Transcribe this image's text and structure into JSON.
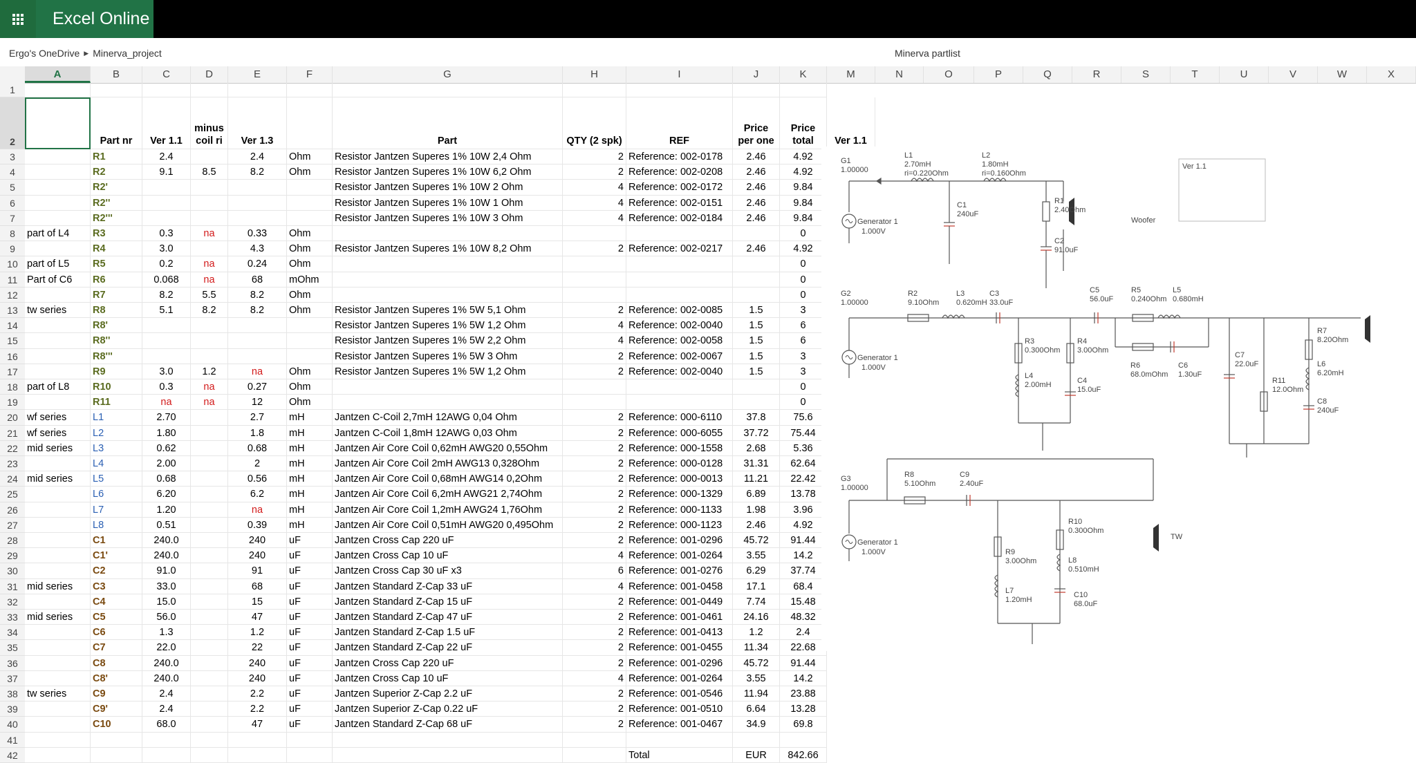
{
  "app": {
    "name": "Excel Online"
  },
  "breadcrumb": {
    "drive": "Ergo's OneDrive",
    "folder": "Minerva_project"
  },
  "document": {
    "title": "Minerva partlist"
  },
  "columns": [
    "A",
    "B",
    "C",
    "D",
    "E",
    "F",
    "G",
    "H",
    "I",
    "J",
    "K",
    "M",
    "N",
    "O",
    "P",
    "Q",
    "R",
    "S",
    "T",
    "U",
    "V",
    "W",
    "X"
  ],
  "header_row": {
    "part_nr": "Part nr",
    "ver11": "Ver 1.1",
    "minus_coil_ri": "minus coil ri",
    "ver13": "Ver 1.3",
    "part": "Part",
    "qty": "QTY (2 spk)",
    "ref": "REF",
    "price_per_one": "Price per one",
    "price_total": "Price total",
    "ver11_schematic": "Ver 1.1"
  },
  "rows": [
    {
      "n": 3,
      "a": "",
      "b": "R1",
      "c": "2.4",
      "d": "",
      "e": "2.4",
      "f": "Ohm",
      "g": "Resistor Jantzen Superes 1% 10W 2,4 Ohm",
      "h": "2",
      "i": "Reference:  002-0178",
      "j": "2.46",
      "k": "4.92",
      "t": "r"
    },
    {
      "n": 4,
      "a": "",
      "b": "R2",
      "c": "9.1",
      "d": "8.5",
      "e": "8.2",
      "f": "Ohm",
      "g": "Resistor Jantzen Superes 1% 10W 6,2 Ohm",
      "h": "2",
      "i": "Reference:  002-0208",
      "j": "2.46",
      "k": "4.92",
      "t": "r"
    },
    {
      "n": 5,
      "a": "",
      "b": "R2'",
      "c": "",
      "d": "",
      "e": "",
      "f": "",
      "g": "Resistor Jantzen Superes 1% 10W 2 Ohm",
      "h": "4",
      "i": "Reference:  002-0172",
      "j": "2.46",
      "k": "9.84",
      "t": "r"
    },
    {
      "n": 6,
      "a": "",
      "b": "R2''",
      "c": "",
      "d": "",
      "e": "",
      "f": "",
      "g": "Resistor Jantzen Superes 1% 10W 1 Ohm",
      "h": "4",
      "i": "Reference:  002-0151",
      "j": "2.46",
      "k": "9.84",
      "t": "r"
    },
    {
      "n": 7,
      "a": "",
      "b": "R2'''",
      "c": "",
      "d": "",
      "e": "",
      "f": "",
      "g": "Resistor Jantzen Superes 1% 10W 3 Ohm",
      "h": "4",
      "i": "Reference:  002-0184",
      "j": "2.46",
      "k": "9.84",
      "t": "r"
    },
    {
      "n": 8,
      "a": "part of L4",
      "b": "R3",
      "c": "0.3",
      "d": "na",
      "e": "0.33",
      "f": "Ohm",
      "g": "",
      "h": "",
      "i": "",
      "j": "",
      "k": "0",
      "t": "r"
    },
    {
      "n": 9,
      "a": "",
      "b": "R4",
      "c": "3.0",
      "d": "",
      "e": "4.3",
      "f": "Ohm",
      "g": "Resistor Jantzen Superes 1% 10W 8,2 Ohm",
      "h": "2",
      "i": "Reference:  002-0217",
      "j": "2.46",
      "k": "4.92",
      "t": "r"
    },
    {
      "n": 10,
      "a": "part of L5",
      "b": "R5",
      "c": "0.2",
      "d": "na",
      "e": "0.24",
      "f": "Ohm",
      "g": "",
      "h": "",
      "i": "",
      "j": "",
      "k": "0",
      "t": "r"
    },
    {
      "n": 11,
      "a": "Part of C6",
      "b": "R6",
      "c": "0.068",
      "d": "na",
      "e": "68",
      "f": "mOhm",
      "g": "",
      "h": "",
      "i": "",
      "j": "",
      "k": "0",
      "t": "r"
    },
    {
      "n": 12,
      "a": "",
      "b": "R7",
      "c": "8.2",
      "d": "5.5",
      "e": "8.2",
      "f": "Ohm",
      "g": "",
      "h": "",
      "i": "",
      "j": "",
      "k": "0",
      "t": "r"
    },
    {
      "n": 13,
      "a": "tw series",
      "b": "R8",
      "c": "5.1",
      "d": "8.2",
      "e": "8.2",
      "f": "Ohm",
      "g": "Resistor Jantzen Superes 1% 5W 5,1 Ohm",
      "h": "2",
      "i": "Reference:  002-0085",
      "j": "1.5",
      "k": "3",
      "t": "r"
    },
    {
      "n": 14,
      "a": "",
      "b": "R8'",
      "c": "",
      "d": "",
      "e": "",
      "f": "",
      "g": "Resistor Jantzen Superes 1% 5W 1,2 Ohm",
      "h": "4",
      "i": "Reference:  002-0040",
      "j": "1.5",
      "k": "6",
      "t": "r"
    },
    {
      "n": 15,
      "a": "",
      "b": "R8''",
      "c": "",
      "d": "",
      "e": "",
      "f": "",
      "g": "Resistor Jantzen Superes 1% 5W 2,2 Ohm",
      "h": "4",
      "i": "Reference:  002-0058",
      "j": "1.5",
      "k": "6",
      "t": "r"
    },
    {
      "n": 16,
      "a": "",
      "b": "R8'''",
      "c": "",
      "d": "",
      "e": "",
      "f": "",
      "g": "Resistor Jantzen Superes 1% 5W 3 Ohm",
      "h": "2",
      "i": "Reference:  002-0067",
      "j": "1.5",
      "k": "3",
      "t": "r"
    },
    {
      "n": 17,
      "a": "",
      "b": "R9",
      "c": "3.0",
      "d": "1.2",
      "e": "na",
      "f": "Ohm",
      "g": "Resistor Jantzen Superes 1% 5W 1,2 Ohm",
      "h": "2",
      "i": "Reference:  002-0040",
      "j": "1.5",
      "k": "3",
      "t": "r"
    },
    {
      "n": 18,
      "a": "part of L8",
      "b": "R10",
      "c": "0.3",
      "d": "na",
      "e": "0.27",
      "f": "Ohm",
      "g": "",
      "h": "",
      "i": "",
      "j": "",
      "k": "0",
      "t": "r"
    },
    {
      "n": 19,
      "a": "",
      "b": "R11",
      "c": "na",
      "d": "na",
      "e": "12",
      "f": "Ohm",
      "g": "",
      "h": "",
      "i": "",
      "j": "",
      "k": "0",
      "t": "r"
    },
    {
      "n": 20,
      "a": "wf series",
      "b": "L1",
      "c": "2.70",
      "d": "",
      "e": "2.7",
      "f": "mH",
      "g": "Jantzen C-Coil 2,7mH 12AWG 0,04 Ohm",
      "h": "2",
      "i": "Reference:  000-6110",
      "j": "37.8",
      "k": "75.6",
      "t": "l"
    },
    {
      "n": 21,
      "a": "wf series",
      "b": "L2",
      "c": "1.80",
      "d": "",
      "e": "1.8",
      "f": "mH",
      "g": "Jantzen C-Coil 1,8mH 12AWG 0,03 Ohm",
      "h": "2",
      "i": "Reference:  000-6055",
      "j": "37.72",
      "k": "75.44",
      "t": "l"
    },
    {
      "n": 22,
      "a": "mid series",
      "b": "L3",
      "c": "0.62",
      "d": "",
      "e": "0.68",
      "f": "mH",
      "g": "Jantzen Air Core Coil 0,62mH AWG20 0,55Ohm",
      "h": "2",
      "i": "Reference:  000-1558",
      "j": "2.68",
      "k": "5.36",
      "t": "l"
    },
    {
      "n": 23,
      "a": "",
      "b": "L4",
      "c": "2.00",
      "d": "",
      "e": "2",
      "f": "mH",
      "g": "Jantzen Air Core Coil 2mH AWG13 0,328Ohm",
      "h": "2",
      "i": "Reference:  000-0128",
      "j": "31.31",
      "k": "62.64",
      "t": "l"
    },
    {
      "n": 24,
      "a": "mid series",
      "b": "L5",
      "c": "0.68",
      "d": "",
      "e": "0.56",
      "f": "mH",
      "g": "Jantzen Air Core Coil 0,68mH AWG14 0,2Ohm",
      "h": "2",
      "i": "Reference:  000-0013",
      "j": "11.21",
      "k": "22.42",
      "t": "l"
    },
    {
      "n": 25,
      "a": "",
      "b": "L6",
      "c": "6.20",
      "d": "",
      "e": "6.2",
      "f": "mH",
      "g": "Jantzen Air Core Coil 6,2mH AWG21 2,74Ohm",
      "h": "2",
      "i": "Reference:  000-1329",
      "j": "6.89",
      "k": "13.78",
      "t": "l"
    },
    {
      "n": 26,
      "a": "",
      "b": "L7",
      "c": "1.20",
      "d": "",
      "e": "na",
      "f": "mH",
      "g": "Jantzen Air Core Coil 1,2mH AWG24 1,76Ohm",
      "h": "2",
      "i": "Reference: 000-1133",
      "j": "1.98",
      "k": "3.96",
      "t": "l"
    },
    {
      "n": 27,
      "a": "",
      "b": "L8",
      "c": "0.51",
      "d": "",
      "e": "0.39",
      "f": "mH",
      "g": "Jantzen Air Core Coil 0,51mH AWG20 0,495Ohm",
      "h": "2",
      "i": "Reference: 000-1123",
      "j": "2.46",
      "k": "4.92",
      "t": "l"
    },
    {
      "n": 28,
      "a": "",
      "b": "C1",
      "c": "240.0",
      "d": "",
      "e": "240",
      "f": "uF",
      "g": "Jantzen Cross Cap 220 uF",
      "h": "2",
      "i": "Reference:  001-0296",
      "j": "45.72",
      "k": "91.44",
      "t": "c"
    },
    {
      "n": 29,
      "a": "",
      "b": "C1'",
      "c": "240.0",
      "d": "",
      "e": "240",
      "f": "uF",
      "g": "Jantzen Cross Cap 10 uF",
      "h": "4",
      "i": "Reference:  001-0264",
      "j": "3.55",
      "k": "14.2",
      "t": "c"
    },
    {
      "n": 30,
      "a": "",
      "b": "C2",
      "c": "91.0",
      "d": "",
      "e": "91",
      "f": "uF",
      "g": "Jantzen Cross Cap 30 uF x3",
      "h": "6",
      "i": "Reference:  001-0276",
      "j": "6.29",
      "k": "37.74",
      "t": "c"
    },
    {
      "n": 31,
      "a": "mid series",
      "b": "C3",
      "c": "33.0",
      "d": "",
      "e": "68",
      "f": "uF",
      "g": "Jantzen Standard Z-Cap 33 uF",
      "h": "4",
      "i": "Reference:  001-0458",
      "j": "17.1",
      "k": "68.4",
      "t": "c"
    },
    {
      "n": 32,
      "a": "",
      "b": "C4",
      "c": "15.0",
      "d": "",
      "e": "15",
      "f": "uF",
      "g": "Jantzen Standard Z-Cap  15 uF",
      "h": "2",
      "i": "Reference:  001-0449",
      "j": "7.74",
      "k": "15.48",
      "t": "c"
    },
    {
      "n": 33,
      "a": "mid series",
      "b": "C5",
      "c": "56.0",
      "d": "",
      "e": "47",
      "f": "uF",
      "g": "Jantzen Standard Z-Cap 47 uF",
      "h": "2",
      "i": "Reference:  001-0461",
      "j": "24.16",
      "k": "48.32",
      "t": "c"
    },
    {
      "n": 34,
      "a": "",
      "b": "C6",
      "c": "1.3",
      "d": "",
      "e": "1.2",
      "f": "uF",
      "g": "Jantzen Standard Z-Cap  1.5 uF",
      "h": "2",
      "i": "Reference:  001-0413",
      "j": "1.2",
      "k": "2.4",
      "t": "c"
    },
    {
      "n": 35,
      "a": "",
      "b": "C7",
      "c": "22.0",
      "d": "",
      "e": "22",
      "f": "uF",
      "g": "Jantzen Standard Z-Cap 22 uF",
      "h": "2",
      "i": "Reference:  001-0455",
      "j": "11.34",
      "k": "22.68",
      "t": "c"
    },
    {
      "n": 36,
      "a": "",
      "b": "C8",
      "c": "240.0",
      "d": "",
      "e": "240",
      "f": "uF",
      "g": "Jantzen Cross Cap 220 uF",
      "h": "2",
      "i": "Reference:  001-0296",
      "j": "45.72",
      "k": "91.44",
      "t": "c"
    },
    {
      "n": 37,
      "a": "",
      "b": "C8'",
      "c": "240.0",
      "d": "",
      "e": "240",
      "f": "uF",
      "g": "Jantzen Cross Cap 10 uF",
      "h": "4",
      "i": "Reference:  001-0264",
      "j": "3.55",
      "k": "14.2",
      "t": "c"
    },
    {
      "n": 38,
      "a": "tw series",
      "b": "C9",
      "c": "2.4",
      "d": "",
      "e": "2.2",
      "f": "uF",
      "g": "Jantzen Superior Z-Cap 2.2 uF",
      "h": "2",
      "i": "Reference:  001-0546",
      "j": "11.94",
      "k": "23.88",
      "t": "c"
    },
    {
      "n": 39,
      "a": "",
      "b": "C9'",
      "c": "2.4",
      "d": "",
      "e": "2.2",
      "f": "uF",
      "g": "Jantzen Superior Z-Cap 0.22 uF",
      "h": "2",
      "i": "Reference: 001-0510",
      "j": "6.64",
      "k": "13.28",
      "t": "c"
    },
    {
      "n": 40,
      "a": "",
      "b": "C10",
      "c": "68.0",
      "d": "",
      "e": "47",
      "f": "uF",
      "g": "Jantzen Standard Z-Cap 68 uF",
      "h": "2",
      "i": "Reference:  001-0467",
      "j": "34.9",
      "k": "69.8",
      "t": "c"
    }
  ],
  "total_row": {
    "label": "Total",
    "currency": "EUR",
    "value": "842.66"
  },
  "schematic": {
    "version_label": "Ver 1.1",
    "woofer": "Woofer",
    "tweeter": "TW",
    "gen_label": "Generator 1",
    "gen_v": "1.000V",
    "g1": "G1",
    "g2": "G2",
    "g3": "G3",
    "g_val": "1.00000",
    "parts": {
      "L1": "L1",
      "L1v": "2.70mH",
      "L1r": "ri=0.220Ohm",
      "L2": "L2",
      "L2v": "1.80mH",
      "L2r": "ri=0.160Ohm",
      "C1": "C1",
      "C1v": "240uF",
      "R1": "R1",
      "R1v": "2.40Ohm",
      "C2": "C2",
      "C2v": "91.0uF",
      "R2": "R2",
      "R2v": "9.10Ohm",
      "L3": "L3",
      "L3v": "0.620mH",
      "C3": "C3",
      "C3v": "33.0uF",
      "C5": "C5",
      "C5v": "56.0uF",
      "R5": "R5",
      "R5v": "0.240Ohm",
      "L5": "L5",
      "L5v": "0.680mH",
      "R3": "R3",
      "R3v": "0.300Ohm",
      "R4": "R4",
      "R4v": "3.00Ohm",
      "L4": "L4",
      "L4v": "2.00mH",
      "C4": "C4",
      "C4v": "15.0uF",
      "R6": "R6",
      "R6v": "68.0mOhm",
      "C6": "C6",
      "C6v": "1.30uF",
      "C7": "C7",
      "C7v": "22.0uF",
      "R11": "R11",
      "R11v": "12.0Ohm",
      "R7": "R7",
      "R7v": "8.20Ohm",
      "L6": "L6",
      "L6v": "6.20mH",
      "C8": "C8",
      "C8v": "240uF",
      "R8": "R8",
      "R8v": "5.10Ohm",
      "C9": "C9",
      "C9v": "2.40uF",
      "R10": "R10",
      "R10v": "0.300Ohm",
      "L8": "L8",
      "L8v": "0.510mH",
      "R9": "R9",
      "R9v": "3.00Ohm",
      "L7": "L7",
      "L7v": "1.20mH",
      "C10": "C10",
      "C10v": "68.0uF"
    },
    "nodes": [
      "1",
      "7",
      "8",
      "2",
      "9",
      "0",
      "3",
      "10",
      "11",
      "12",
      "13",
      "16",
      "17",
      "4",
      "14",
      "15",
      "18",
      "28",
      "19",
      "20",
      "5",
      "21",
      "22",
      "23",
      "6",
      "24",
      "25",
      "26",
      "27"
    ]
  }
}
